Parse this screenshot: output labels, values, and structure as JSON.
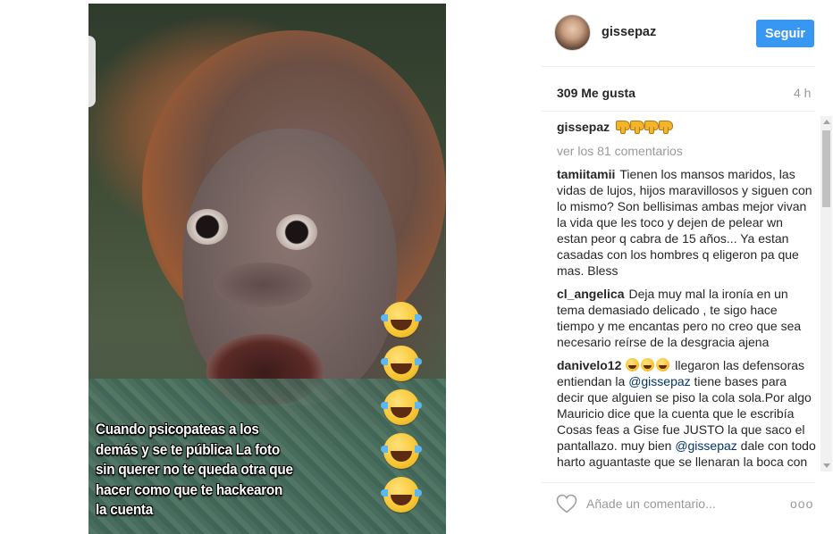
{
  "post": {
    "image_caption": "Cuando psicopateas a los demás y se te pública La foto sin querer no te queda otra que hacer como que te hackearon la cuenta"
  },
  "header": {
    "username": "gissepaz",
    "follow_label": "Seguir"
  },
  "stats": {
    "likes": "309 Me gusta",
    "time": "4 h"
  },
  "caption": {
    "username": "gissepaz"
  },
  "view_all": "ver los 81 comentarios",
  "comments": [
    {
      "username": "tamiitamii",
      "text": "Tienen los mansos maridos, las vidas de lujos, hijos maravillosos y siguen con lo mismo? Son bellisimas ambas mejor vivan la vida que les toco y dejen de pelear wn estan peor q cabra de 15 años... Ya estan casadas con los hombres q eligeron pa que mas. Bless"
    },
    {
      "username": "cl_angelica",
      "text": "Deja muy mal la ironía en un tema demasiado delicado , te sigo hace tiempo y me encantas pero no creo que sea necesario reírse de la desgracia ajena"
    },
    {
      "username": "danivelo12",
      "text_a": " llegaron las defensoras entiendan la ",
      "mention": "@gissepaz",
      "text_b": " tiene bases para decir que alguien se piso la cola sola.Por algo Mauricio dice que la cuenta que le escribía Cosas feas a Gise fue JUSTO la que saco el pantallazo. muy bien ",
      "mention2": "@gissepaz",
      "text_c": " dale con todo harto aguantaste que se llenaran la boca con tu"
    }
  ],
  "footer": {
    "comment_placeholder": "Añade un comentario...",
    "more_label": "ooo"
  },
  "icons": {
    "heart": "heart-outline-icon",
    "thumbs_down": "thumbs-down-emoji",
    "laughing": "tears-of-joy-emoji",
    "grin": "grinning-emoji"
  },
  "colors": {
    "follow_button": "#3897f0",
    "mention": "#003569",
    "muted": "#999999"
  }
}
